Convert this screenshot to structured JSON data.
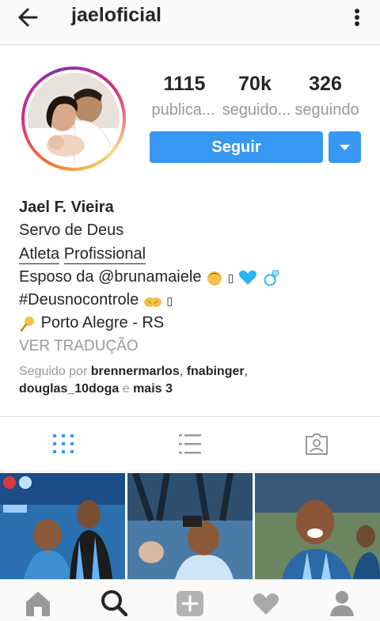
{
  "header": {
    "title": "jaeloficial",
    "back_icon": "arrow-left-icon",
    "more_icon": "more-vertical-icon"
  },
  "profile": {
    "stats": [
      {
        "value": "1115",
        "label": "publica..."
      },
      {
        "value": "70k",
        "label": "seguido..."
      },
      {
        "value": "326",
        "label": "seguindo"
      }
    ],
    "follow_label": "Seguir",
    "colors": {
      "accent": "#3897f0",
      "muted": "#999999",
      "text": "#262626"
    }
  },
  "bio": {
    "name": "Jael F. Vieira",
    "line1": "Servo de Deus",
    "line2a": "Atleta",
    "line2b": "Profissional",
    "line3": "Esposo da @brunamaiele",
    "line3_tail": "▯",
    "line4": "#Deusnocontrole",
    "line4_tail": "▯",
    "line5": "Porto Alegre - RS",
    "translate": "VER TRADUÇÃO"
  },
  "followed_by": {
    "prefix": "Seguido por",
    "user1": "brennermarlos",
    "sep1": ",",
    "user2": "fnabinger",
    "sep2": ",",
    "user3": "douglas_10doga",
    "conj": "e",
    "more": "mais 3"
  },
  "tabs": [
    "grid-icon",
    "list-icon",
    "tagged-icon"
  ],
  "bottom_nav": [
    "home-icon",
    "search-icon",
    "add-icon",
    "heart-icon",
    "profile-icon"
  ]
}
